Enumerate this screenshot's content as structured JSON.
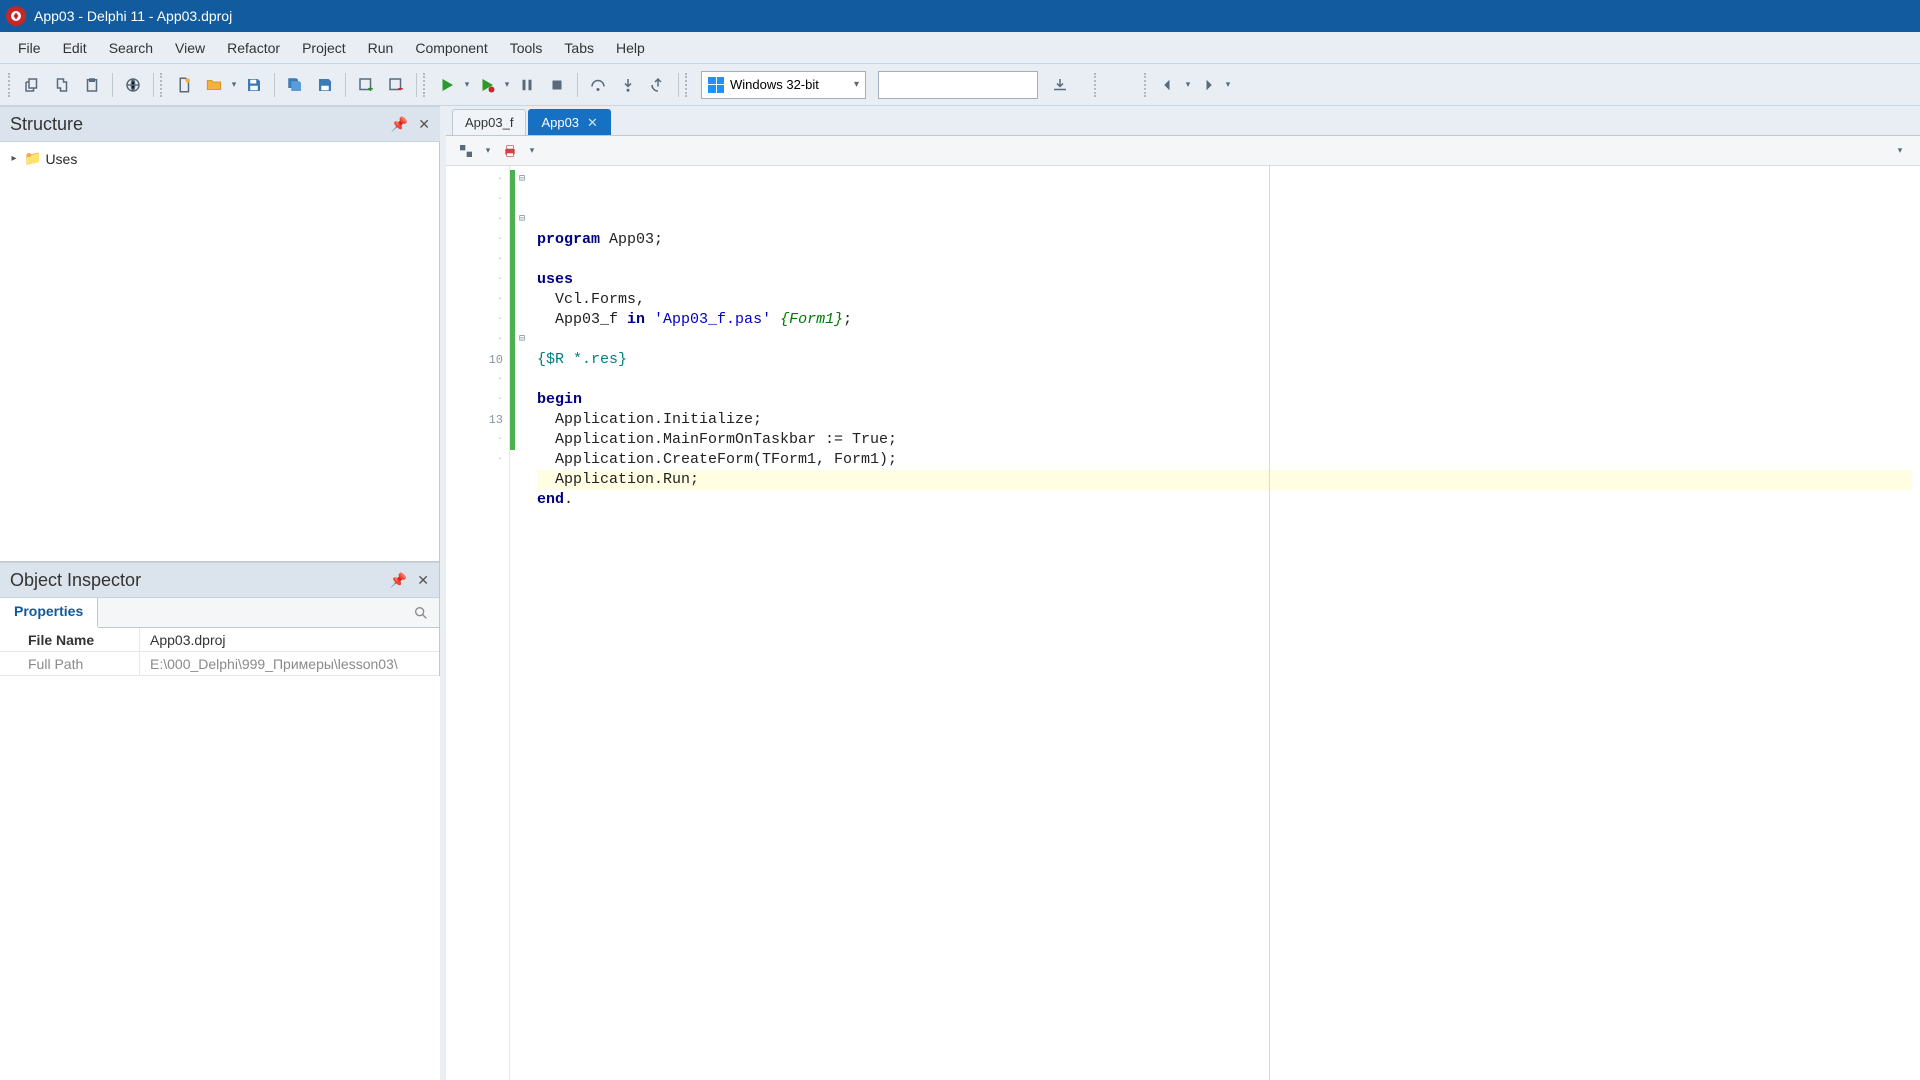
{
  "title": "App03 - Delphi 11 - App03.dproj",
  "menubar": [
    "File",
    "Edit",
    "Search",
    "View",
    "Refactor",
    "Project",
    "Run",
    "Component",
    "Tools",
    "Tabs",
    "Help"
  ],
  "toolbar": {
    "platform": "Windows 32-bit"
  },
  "structure": {
    "title": "Structure",
    "root": "Uses"
  },
  "inspector": {
    "title": "Object Inspector",
    "tab": "Properties",
    "rows": [
      {
        "key": "File Name",
        "val": "App03.dproj",
        "highlight": true
      },
      {
        "key": "Full Path",
        "val": "E:\\000_Delphi\\999_Примеры\\lesson03\\",
        "dim": true
      }
    ]
  },
  "editor": {
    "tabs": [
      {
        "label": "App03_f",
        "active": false
      },
      {
        "label": "App03",
        "active": true
      }
    ],
    "visible_line_numbers": {
      "10": 10,
      "13": 13
    },
    "highlight_line_index": 12,
    "code": [
      {
        "t": [
          [
            "kw",
            "program"
          ],
          [
            "",
            " App03;"
          ]
        ]
      },
      {
        "t": [
          [
            "",
            ""
          ]
        ]
      },
      {
        "t": [
          [
            "kw",
            "uses"
          ]
        ],
        "cursor": true
      },
      {
        "t": [
          [
            "",
            "  Vcl.Forms,"
          ]
        ]
      },
      {
        "t": [
          [
            "",
            "  App03_f "
          ],
          [
            "kw",
            "in"
          ],
          [
            "",
            " "
          ],
          [
            "str",
            "'App03_f.pas'"
          ],
          [
            "",
            " "
          ],
          [
            "cmt",
            "{Form1}"
          ],
          [
            "",
            ";"
          ]
        ]
      },
      {
        "t": [
          [
            "",
            ""
          ]
        ]
      },
      {
        "t": [
          [
            "dir",
            "{$R *.res}"
          ]
        ]
      },
      {
        "t": [
          [
            "",
            ""
          ]
        ]
      },
      {
        "t": [
          [
            "kw",
            "begin"
          ]
        ]
      },
      {
        "t": [
          [
            "",
            "  Application.Initialize;"
          ]
        ]
      },
      {
        "t": [
          [
            "",
            "  Application.MainFormOnTaskbar := True;"
          ]
        ]
      },
      {
        "t": [
          [
            "",
            "  Application.CreateForm(TForm1, Form1);"
          ]
        ]
      },
      {
        "t": [
          [
            "",
            "  Application.Run;"
          ]
        ]
      },
      {
        "t": [
          [
            "kw",
            "end"
          ],
          [
            "",
            "."
          ]
        ]
      }
    ]
  }
}
